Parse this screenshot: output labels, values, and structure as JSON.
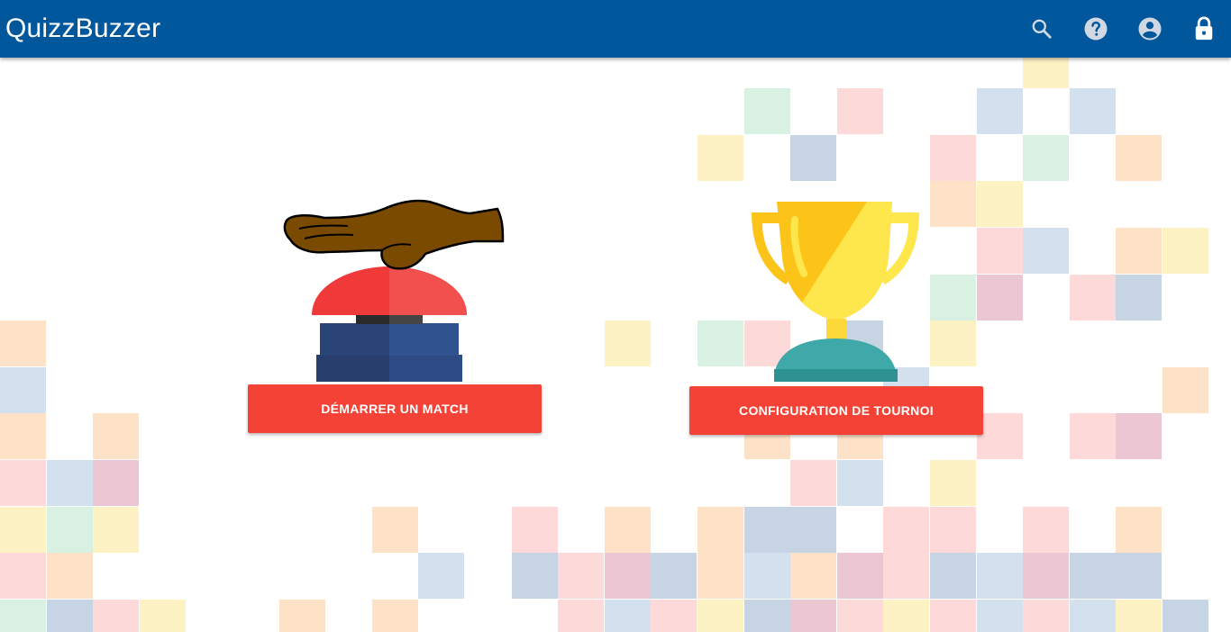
{
  "app": {
    "title": "QuizzBuzzer"
  },
  "toolbar": {
    "icons": [
      "search-icon",
      "help-icon",
      "account-icon",
      "lock-icon"
    ],
    "background_color": "#01579b",
    "icon_color": "#cfd8e3"
  },
  "main": {
    "start_match_label": "DÉMARRER UN MATCH",
    "tournament_config_label": "CONFIGURATION DE TOURNOI",
    "button_color": "#f44336",
    "illustrations": [
      "buzzer-hand-illustration",
      "trophy-illustration"
    ]
  },
  "background": {
    "tile_colors": [
      "#fdd9d9",
      "#d3e0ee",
      "#fdf2c4",
      "#d8f1e3",
      "#fde2c7",
      "#c7d4e3",
      "#ecc7d3"
    ]
  }
}
